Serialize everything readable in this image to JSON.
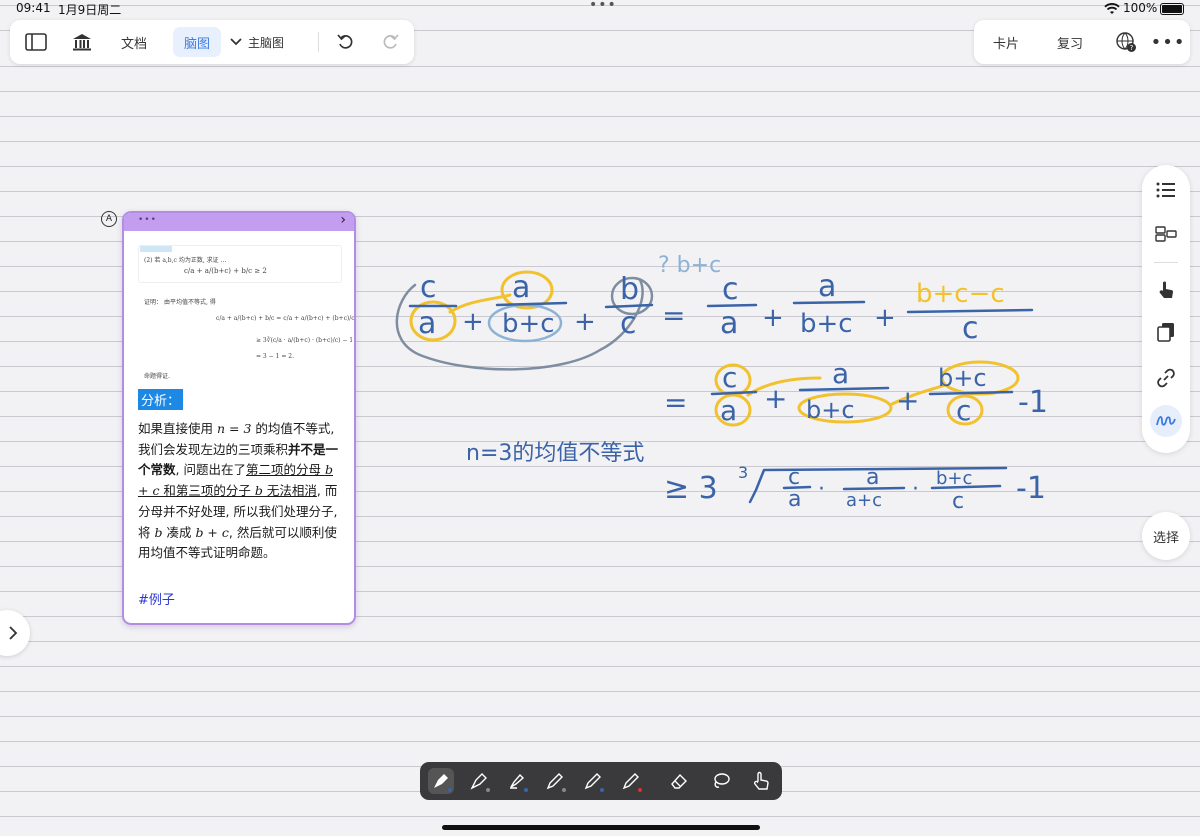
{
  "status": {
    "time": "09:41",
    "date": "1月9日周二",
    "battery": "100%"
  },
  "toolbar": {
    "doc_label": "文档",
    "mindmap_label": "脑图",
    "main_mindmap_label": "主脑图",
    "cards_label": "卡片",
    "review_label": "复习"
  },
  "side": {
    "select_label": "选择"
  },
  "card": {
    "problem_line": "(2) 若 a,b,c 均为正数, 求证 …",
    "proof_label": "证明：",
    "proof_intro": "由平均值不等式, 得",
    "conclusion": "命题得证.",
    "analysis_label": "分析：",
    "p1": "如果直接使用 ",
    "p1_math": "n = 3",
    "p2": " 的均值不等式, 我们会发现左边的三项乘积",
    "p3_bold": "并不是一个常数",
    "p4": ", 问题出在了",
    "p5_u": "第二项的分母 ",
    "p5_math": "b + c",
    "p6_u": " 和第三项的分子 ",
    "p6_math": "b",
    "p7_u": " 无法相消",
    "p8": ", 而分母并不好处理, 所以我们处理分子, 将 ",
    "p8_math": "b",
    "p9": " 凑成 ",
    "p9_math": "b + c",
    "p10": ", 然后就可以顺利使用均值不等式证明命题。",
    "tag": "#例子"
  },
  "handwriting": {
    "hint": "? b+c",
    "line1_terms": [
      "c",
      "a",
      "a",
      "b+c",
      "b",
      "c",
      "=",
      "c",
      "a",
      "a",
      "b+c",
      "b+c-c",
      "c"
    ],
    "line2_tail": "-1",
    "n3_label": "n=3的均值不等式",
    "line3_prefix": "≥ 3",
    "line3_root": "3",
    "line3_tail": "-1"
  },
  "colors": {
    "ink_blue": "#3a63a8",
    "highlight_yellow": "#f2c12e",
    "lasso_blue": "#8cb3d6",
    "card_border": "#b38ee0",
    "accent": "#3d7be0"
  }
}
